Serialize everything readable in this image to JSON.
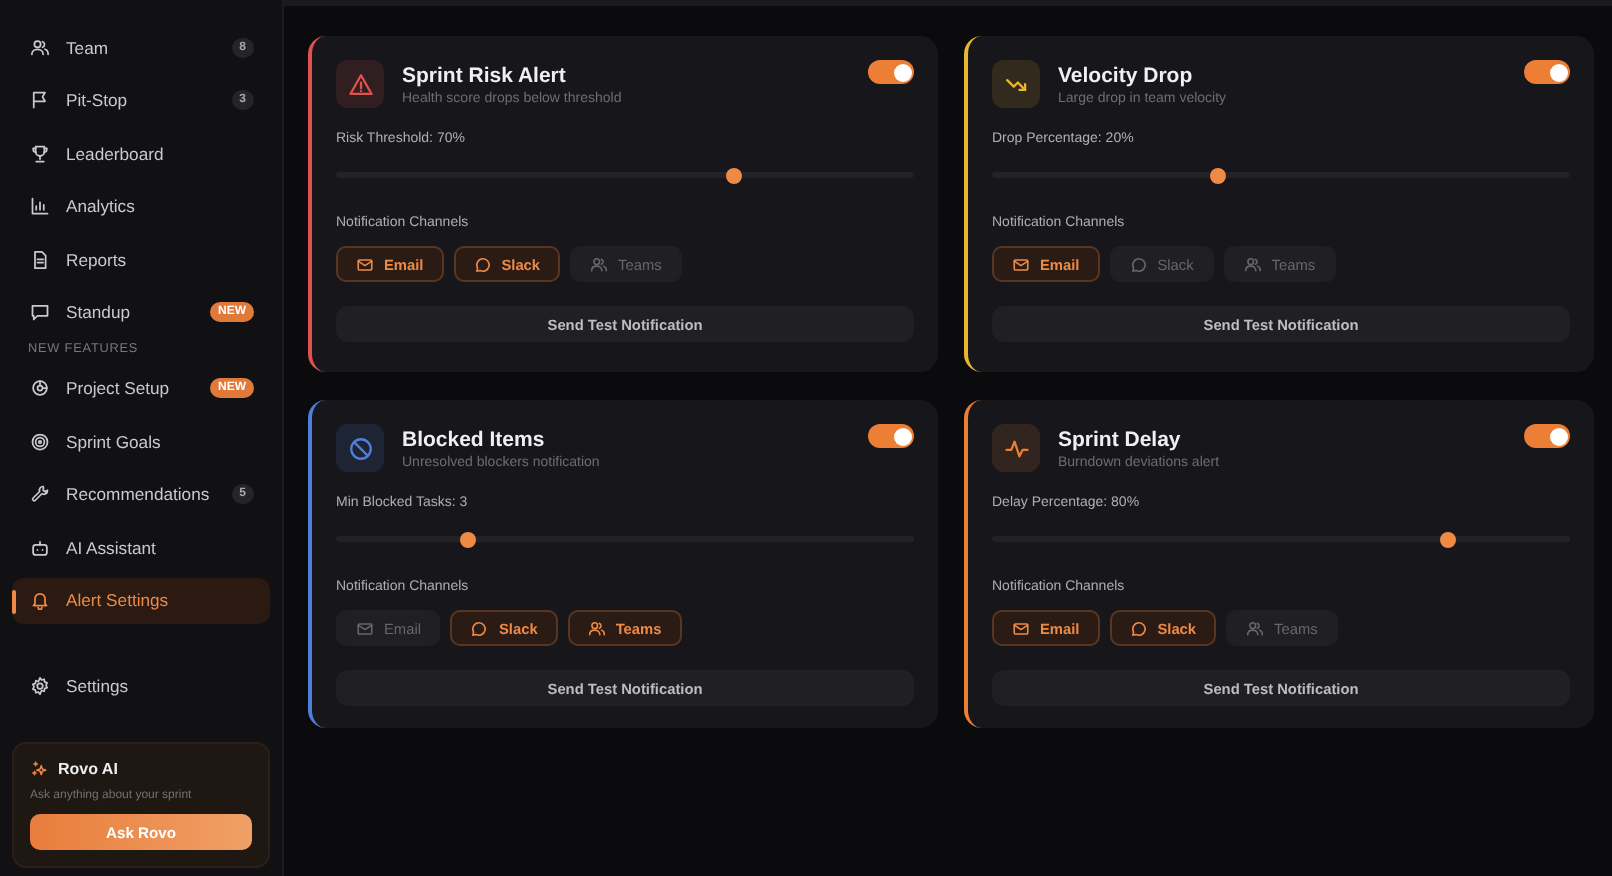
{
  "sidebar": {
    "items": [
      {
        "kind": "count",
        "label": "Team",
        "badge": "8",
        "selected": false
      },
      {
        "kind": "count",
        "label": "Pit-Stop",
        "badge": "3",
        "selected": false
      },
      {
        "kind": "plain",
        "label": "Leaderboard",
        "selected": false
      },
      {
        "kind": "plain",
        "label": "Analytics",
        "selected": false
      },
      {
        "kind": "plain",
        "label": "Reports",
        "selected": false
      },
      {
        "kind": "new",
        "label": "Standup",
        "badge": "NEW",
        "selected": false
      },
      {
        "kind": "heading",
        "label": "NEW FEATURES"
      },
      {
        "kind": "new",
        "label": "Project Setup",
        "badge": "NEW",
        "selected": false
      },
      {
        "kind": "plain",
        "label": "Sprint Goals",
        "selected": false
      },
      {
        "kind": "count",
        "label": "Recommendations",
        "badge": "5",
        "selected": false
      },
      {
        "kind": "plain",
        "label": "AI Assistant",
        "selected": false
      },
      {
        "kind": "plain",
        "label": "Alert Settings",
        "selected": true
      }
    ],
    "settings": {
      "label": "Settings"
    },
    "promo": {
      "title": "Rovo AI",
      "text": "Ask anything about your sprint",
      "button": "Ask Rovo"
    }
  },
  "alerts": [
    {
      "color": "#e0524e",
      "title": "Sprint Risk Alert",
      "subtitle": "Health score drops below threshold",
      "enabled": true,
      "slider_label": "Risk Threshold: 70%",
      "level": 0.69,
      "channels_label": "Notification Channels",
      "channels": [
        {
          "kind": "email",
          "label": "Email",
          "on": true
        },
        {
          "kind": "slack",
          "label": "Slack",
          "on": true
        },
        {
          "kind": "teams",
          "label": "Teams",
          "on": false
        }
      ],
      "button": "Send Test Notification"
    },
    {
      "color": "#e8b630",
      "title": "Velocity Drop",
      "subtitle": "Large drop in team velocity",
      "enabled": true,
      "slider_label": "Drop Percentage: 20%",
      "level": 0.39,
      "channels_label": "Notification Channels",
      "channels": [
        {
          "kind": "email",
          "label": "Email",
          "on": true
        },
        {
          "kind": "slack",
          "label": "Slack",
          "on": false
        },
        {
          "kind": "teams",
          "label": "Teams",
          "on": false
        }
      ],
      "button": "Send Test Notification"
    },
    {
      "color": "#4f7fdc",
      "title": "Blocked Items",
      "subtitle": "Unresolved blockers notification",
      "enabled": true,
      "slider_label": "Min Blocked Tasks: 3",
      "level": 0.23,
      "channels_label": "Notification Channels",
      "channels": [
        {
          "kind": "email",
          "label": "Email",
          "on": false
        },
        {
          "kind": "slack",
          "label": "Slack",
          "on": true
        },
        {
          "kind": "teams",
          "label": "Teams",
          "on": true
        }
      ],
      "button": "Send Test Notification"
    },
    {
      "color": "#ec7f35",
      "title": "Sprint Delay",
      "subtitle": "Burndown deviations alert",
      "enabled": true,
      "slider_label": "Delay Percentage: 80%",
      "level": 0.79,
      "channels_label": "Notification Channels",
      "channels": [
        {
          "kind": "email",
          "label": "Email",
          "on": true
        },
        {
          "kind": "slack",
          "label": "Slack",
          "on": true
        },
        {
          "kind": "teams",
          "label": "Teams",
          "on": false
        }
      ],
      "button": "Send Test Notification"
    }
  ]
}
